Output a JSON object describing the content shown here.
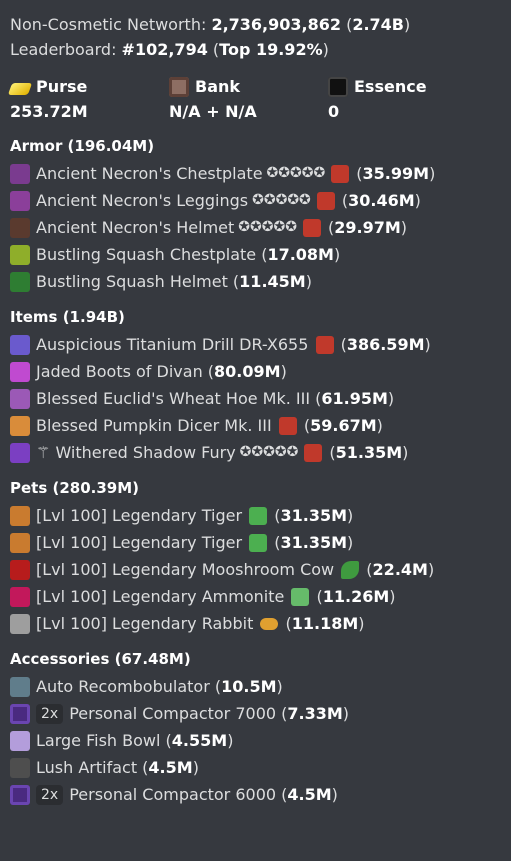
{
  "networth": {
    "label": "Non-Cosmetic Networth:",
    "value": "2,736,903,862",
    "short": "2.74B"
  },
  "leaderboard": {
    "label": "Leaderboard:",
    "rank": "#102,794",
    "top": "Top 19.92%"
  },
  "stats": [
    {
      "label": "Purse",
      "value": "253.72M",
      "icon": "gold-ingot-icon"
    },
    {
      "label": "Bank",
      "value": "N/A + N/A",
      "icon": "bank-head-icon"
    },
    {
      "label": "Essence",
      "value": "0",
      "icon": "essence-head-icon"
    }
  ],
  "sections": [
    {
      "title": "Armor (196.04M)",
      "items": [
        {
          "name": "Ancient Necron's Chestplate",
          "stars": "✪✪✪✪✪",
          "recomb": true,
          "price": "35.99M",
          "icon_color": "#7a3b8f"
        },
        {
          "name": "Ancient Necron's Leggings",
          "stars": "✪✪✪✪✪",
          "recomb": true,
          "price": "30.46M",
          "icon_color": "#8b3f9a"
        },
        {
          "name": "Ancient Necron's Helmet",
          "stars": "✪✪✪✪✪",
          "recomb": true,
          "price": "29.97M",
          "icon_color": "#5a3a2e"
        },
        {
          "name": "Bustling Squash Chestplate",
          "stars": "",
          "recomb": false,
          "price": "17.08M",
          "icon_color": "#8fae2a"
        },
        {
          "name": "Bustling Squash Helmet",
          "stars": "",
          "recomb": false,
          "price": "11.45M",
          "icon_color": "#2e7d32"
        }
      ]
    },
    {
      "title": "Items (1.94B)",
      "items": [
        {
          "prefix": "",
          "name": "Auspicious Titanium Drill DR-X655",
          "stars": "",
          "recomb": true,
          "price": "386.59M",
          "icon_color": "#6a5acd"
        },
        {
          "prefix": "",
          "name": "Jaded Boots of Divan",
          "stars": "",
          "recomb": false,
          "price": "80.09M",
          "icon_color": "#c04ad0"
        },
        {
          "prefix": "",
          "name": "Blessed Euclid's Wheat Hoe Mk. III",
          "stars": "",
          "recomb": false,
          "price": "61.95M",
          "icon_color": "#9b59b6"
        },
        {
          "prefix": "",
          "name": "Blessed Pumpkin Dicer Mk. III",
          "stars": "",
          "recomb": true,
          "price": "59.67M",
          "icon_color": "#d98c3a"
        },
        {
          "prefix": "⚚",
          "name": "Withered Shadow Fury",
          "stars": "✪✪✪✪✪",
          "recomb": true,
          "price": "51.35M",
          "icon_color": "#7b3fc2"
        }
      ]
    },
    {
      "title": "Pets (280.39M)",
      "items": [
        {
          "name": "[Lvl 100] Legendary Tiger",
          "item_icon": "green-head-icon",
          "item_color": "#4caf50",
          "price": "31.35M",
          "icon_color": "#c97b2f"
        },
        {
          "name": "[Lvl 100] Legendary Tiger",
          "item_icon": "green-head-icon",
          "item_color": "#4caf50",
          "price": "31.35M",
          "icon_color": "#c97b2f"
        },
        {
          "name": "[Lvl 100] Legendary Mooshroom Cow",
          "item_icon": "leaf-icon",
          "item_color": "#3f9a3f",
          "price": "22.4M",
          "icon_color": "#b71c1c"
        },
        {
          "name": "[Lvl 100] Legendary Ammonite",
          "item_icon": "creeper-head-icon",
          "item_color": "#66bb6a",
          "price": "11.26M",
          "icon_color": "#c2185b"
        },
        {
          "name": "[Lvl 100] Legendary Rabbit",
          "item_icon": "bread-icon",
          "item_color": "#e0a030",
          "price": "11.18M",
          "icon_color": "#9e9e9e"
        }
      ]
    },
    {
      "title": "Accessories (67.48M)",
      "items": [
        {
          "badge": "",
          "name": "Auto Recombobulator",
          "price": "10.5M",
          "icon_color": "#607d8b"
        },
        {
          "badge": "2x",
          "name": "Personal Compactor 7000",
          "price": "7.33M",
          "icon_color": "#4a2a80"
        },
        {
          "badge": "",
          "name": "Large Fish Bowl",
          "price": "4.55M",
          "icon_color": "#b39ddb"
        },
        {
          "badge": "",
          "name": "Lush Artifact",
          "price": "4.5M",
          "icon_color": "#4e4e4e"
        },
        {
          "badge": "2x",
          "name": "Personal Compactor 6000",
          "price": "4.5M",
          "icon_color": "#4a2a80"
        }
      ]
    }
  ],
  "colors": {
    "background": "#36393f",
    "text": "#dcddde",
    "bold": "#ffffff",
    "recomb": "#c0392b"
  }
}
